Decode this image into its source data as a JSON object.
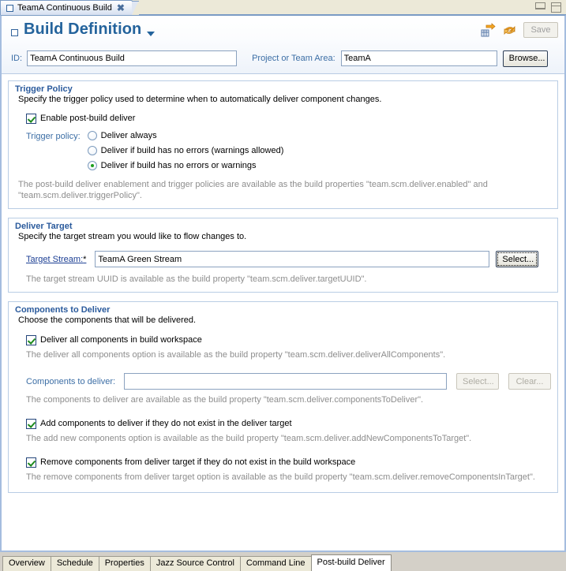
{
  "window": {
    "editor_tab": {
      "title": "TeamA Continuous Build",
      "icon": "build-definition-icon",
      "close_icon": "close-icon"
    },
    "minimize_icon": "minimize-icon",
    "maximize_icon": "maximize-icon"
  },
  "banner": {
    "icon": "build-definition-icon",
    "title": "Build Definition",
    "menu_caret_icon": "chevron-down-icon",
    "tools": [
      {
        "name": "request-build-icon",
        "label": "Request Build"
      },
      {
        "name": "refresh-icon",
        "label": "Refresh"
      }
    ],
    "save_label": "Save",
    "save_enabled": false
  },
  "header_fields": {
    "id_label": "ID:",
    "id_value": "TeamA Continuous Build",
    "project_label": "Project or Team Area:",
    "project_value": "TeamA",
    "browse_label": "Browse..."
  },
  "sections": {
    "trigger_policy": {
      "title": "Trigger Policy",
      "description": "Specify the trigger policy used to determine when to automatically deliver component changes.",
      "enable_checkbox": {
        "label": "Enable post-build deliver",
        "checked": true
      },
      "policy_label": "Trigger policy:",
      "options": [
        {
          "label": "Deliver always",
          "selected": false
        },
        {
          "label": "Deliver if build has no errors (warnings allowed)",
          "selected": false
        },
        {
          "label": "Deliver if build has no errors or warnings",
          "selected": true
        }
      ],
      "hint": "The post-build deliver enablement and trigger policies are available as the build properties \"team.scm.deliver.enabled\" and \"team.scm.deliver.triggerPolicy\"."
    },
    "deliver_target": {
      "title": "Deliver Target",
      "description": "Specify the target stream you would like to flow changes to.",
      "stream_label": "Target Stream:",
      "stream_required_marker": "*",
      "stream_value": "TeamA Green Stream",
      "select_label": "Select...",
      "hint": "The target stream UUID is available as the build property \"team.scm.deliver.targetUUID\"."
    },
    "components_to_deliver": {
      "title": "Components to Deliver",
      "description": "Choose the components that will be delivered.",
      "deliver_all_checkbox": {
        "label": "Deliver all components in build workspace",
        "checked": true
      },
      "deliver_all_hint": "The deliver all components option is available as the build property \"team.scm.deliver.deliverAllComponents\".",
      "components_label": "Components to deliver:",
      "components_value": "",
      "select_label": "Select...",
      "clear_label": "Clear...",
      "components_hint": "The components to deliver are available as the build property \"team.scm.deliver.componentsToDeliver\".",
      "add_checkbox": {
        "label": "Add components to deliver if they do not exist in the deliver target",
        "checked": true
      },
      "add_hint": "The add new components option is available as the build property \"team.scm.deliver.addNewComponentsToTarget\".",
      "remove_checkbox": {
        "label": "Remove components from deliver target if they do not exist in the build workspace",
        "checked": true
      },
      "remove_hint": "The remove components from deliver target option is available as the build property \"team.scm.deliver.removeComponentsInTarget\"."
    }
  },
  "bottom_tabs": [
    {
      "label": "Overview",
      "active": false
    },
    {
      "label": "Schedule",
      "active": false
    },
    {
      "label": "Properties",
      "active": false
    },
    {
      "label": "Jazz Source Control",
      "active": false
    },
    {
      "label": "Command Line",
      "active": false
    },
    {
      "label": "Post-build Deliver",
      "active": true
    }
  ],
  "colors": {
    "accent_blue": "#24639c",
    "section_border": "#b9cde4",
    "link_blue": "#1c3f94",
    "check_green": "#1d8a1d",
    "hint_gray": "#8d8d8d"
  }
}
